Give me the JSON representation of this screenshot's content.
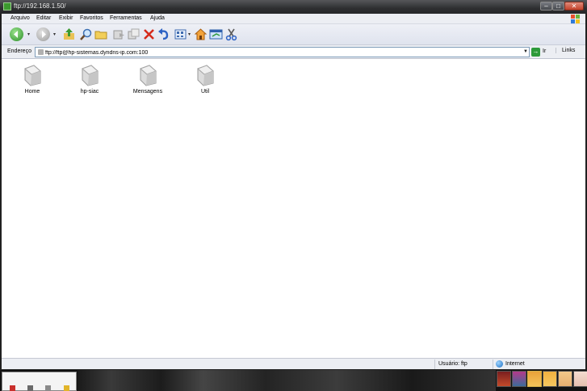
{
  "window": {
    "title": "ftp://192.168.1.50/"
  },
  "menu": [
    "Arquivo",
    "Editar",
    "Exibir",
    "Favoritos",
    "Ferramentas",
    "Ajuda"
  ],
  "toolbar": {
    "icons": [
      "back-icon",
      "forward-icon",
      "up-folder-icon",
      "search-icon",
      "folders-icon",
      "move-to-icon",
      "copy-to-icon",
      "delete-icon",
      "undo-icon",
      "views-icon",
      "home-icon",
      "map-drive-icon",
      "cut-icon"
    ]
  },
  "address": {
    "label": "Endereço",
    "value": "ftp://ftp@hp-sistemas.dyndns-ip.com:100",
    "go_label": "Ir",
    "links_label": "Links"
  },
  "folders": [
    {
      "name": "Home"
    },
    {
      "name": "hp-siac"
    },
    {
      "name": "Mensagens"
    },
    {
      "name": "Util"
    }
  ],
  "status": {
    "user": "Usuário: ftp",
    "zone": "Internet"
  },
  "colors": {
    "titlebar": "#2e2f31",
    "chrome": "#eceef3",
    "content_bg": "#ffffff",
    "go_green": "#2d9a3a"
  }
}
